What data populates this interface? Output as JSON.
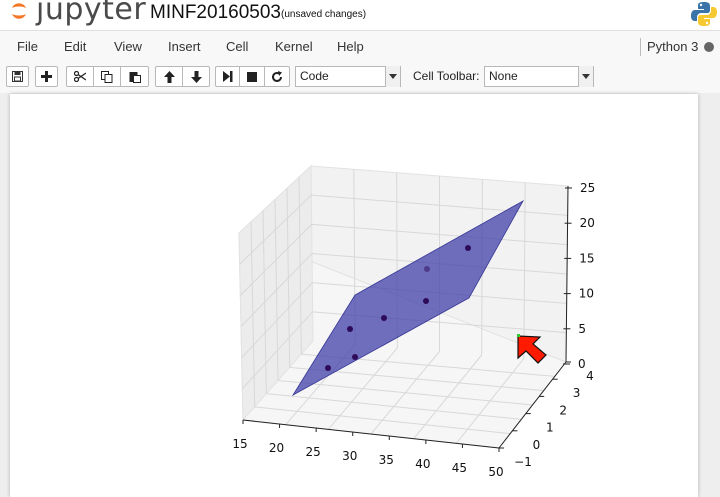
{
  "header": {
    "logo_text": "jupyter",
    "notebook_name": "MINF20160503",
    "save_status": "(unsaved changes)"
  },
  "menu": {
    "items": [
      "File",
      "Edit",
      "View",
      "Insert",
      "Cell",
      "Kernel",
      "Help"
    ],
    "kernel_name": "Python 3"
  },
  "toolbar": {
    "buttons": [
      "save-icon",
      "plus-icon",
      "cut-icon",
      "copy-icon",
      "paste-icon",
      "arrow-up-icon",
      "arrow-down-icon",
      "step-forward-icon",
      "stop-icon",
      "restart-icon"
    ],
    "cell_type": "Code",
    "cell_toolbar_label": "Cell Toolbar:",
    "cell_toolbar_value": "None"
  },
  "colors": {
    "plane": "#4040a8",
    "points": "#2e0a5a",
    "cursor": "#ff1a00"
  },
  "chart_data": {
    "type": "scatter",
    "subtype": "3d-scatter-with-fitted-plane",
    "x_ticks": [
      "15",
      "20",
      "25",
      "30",
      "35",
      "40",
      "45",
      "50"
    ],
    "y_ticks": [
      "−1",
      "0",
      "1",
      "2",
      "3",
      "4"
    ],
    "z_ticks": [
      "0",
      "5",
      "10",
      "15",
      "20",
      "25"
    ],
    "xlim": [
      15,
      50
    ],
    "ylim": [
      -1,
      4
    ],
    "zlim": [
      0,
      25
    ],
    "grid": true
  }
}
